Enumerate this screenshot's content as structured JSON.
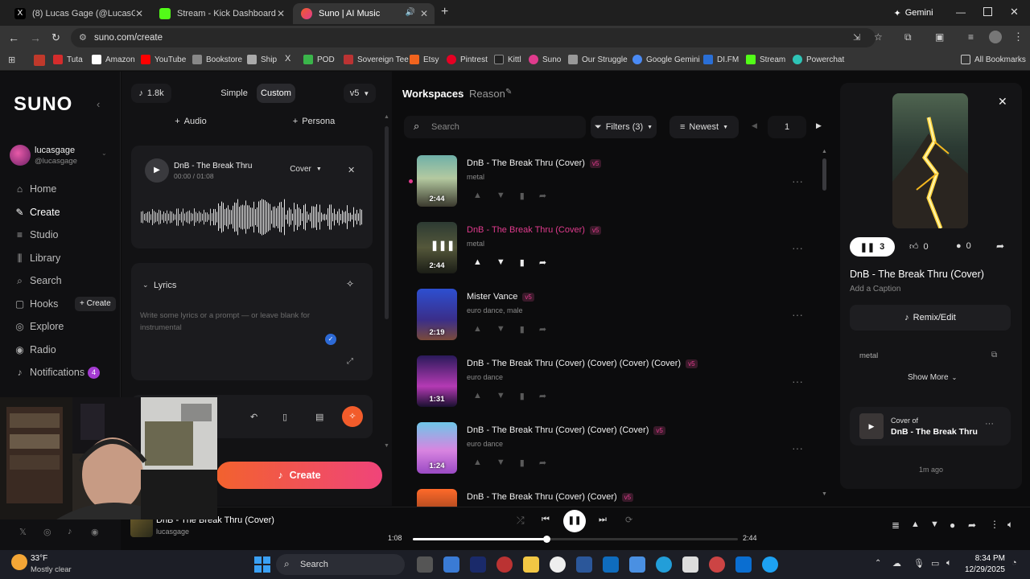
{
  "browser": {
    "tabs": [
      {
        "label": "(8) Lucas Gage (@LucasGageX)",
        "active": false
      },
      {
        "label": "Stream - Kick Dashboard",
        "active": false
      },
      {
        "label": "Suno | AI Music",
        "active": true
      }
    ],
    "gemini_label": "Gemini",
    "url": "suno.com/create",
    "bookmarks": [
      "Tuta",
      "Amazon",
      "YouTube",
      "Bookstore",
      "Ship",
      "POD",
      "Sovereign Tee",
      "Etsy",
      "Pintrest",
      "Kittl",
      "Suno",
      "Our Struggle",
      "Google Gemini",
      "DI.FM",
      "Stream",
      "Powerchat"
    ],
    "all_bookmarks": "All Bookmarks"
  },
  "sidebar": {
    "logo": "SUNO",
    "user_name": "lucasgage",
    "user_handle": "@lucasgage",
    "items": [
      {
        "label": "Home",
        "icon": "home-icon"
      },
      {
        "label": "Create",
        "icon": "create-icon"
      },
      {
        "label": "Studio",
        "icon": "studio-icon"
      },
      {
        "label": "Library",
        "icon": "library-icon"
      },
      {
        "label": "Search",
        "icon": "search-icon"
      },
      {
        "label": "Hooks",
        "icon": "hooks-icon"
      },
      {
        "label": "Explore",
        "icon": "explore-icon"
      },
      {
        "label": "Radio",
        "icon": "radio-icon"
      },
      {
        "label": "Notifications",
        "icon": "bell-icon"
      }
    ],
    "hooks_create": "+ Create",
    "notifications_count": "4"
  },
  "create": {
    "credits": "1.8k",
    "mode_simple": "Simple",
    "mode_custom": "Custom",
    "model": "v5",
    "audio_btn": "Audio",
    "persona_btn": "Persona",
    "track_title": "DnB - The Break Thru",
    "track_time": "00:00 / 01:08",
    "cover_label": "Cover",
    "lyrics_label": "Lyrics",
    "lyrics_placeholder": "Write some lyrics or a prompt — or leave blank for instrumental",
    "create_btn": "Create"
  },
  "workspace": {
    "crumb_root": "Workspaces",
    "crumb_current": "Reason",
    "search_placeholder": "Search",
    "filters": "Filters (3)",
    "sort": "Newest",
    "page": "1",
    "songs": [
      {
        "title": "DnB - The Break Thru (Cover)",
        "tags": "metal",
        "duration": "2:44",
        "badge": "v5",
        "playing": false
      },
      {
        "title": "DnB - The Break Thru (Cover)",
        "tags": "metal",
        "duration": "2:44",
        "badge": "v5",
        "playing": true
      },
      {
        "title": "Mister Vance",
        "tags": "euro dance, male",
        "duration": "2:19",
        "badge": "v5",
        "playing": false
      },
      {
        "title": "DnB - The Break Thru (Cover) (Cover) (Cover) (Cover)",
        "tags": "euro dance",
        "duration": "1:31",
        "badge": "v5",
        "playing": false
      },
      {
        "title": "DnB - The Break Thru (Cover) (Cover) (Cover)",
        "tags": "euro dance",
        "duration": "1:24",
        "badge": "v5",
        "playing": false
      },
      {
        "title": "DnB - The Break Thru (Cover) (Cover)",
        "tags": "",
        "duration": "",
        "badge": "v5",
        "playing": false
      }
    ]
  },
  "detail": {
    "plays": "3",
    "likes": "0",
    "comments": "0",
    "title": "DnB - The Break Thru (Cover)",
    "caption": "Add a Caption",
    "remix": "Remix/Edit",
    "style": "metal",
    "show_more": "Show More",
    "cover_of_label": "Cover of",
    "cover_of_title": "DnB - The Break Thru",
    "age": "1m ago"
  },
  "player": {
    "title": "DnB - The Break Thru (Cover)",
    "artist": "lucasgage",
    "elapsed": "1:08",
    "total": "2:44",
    "progress": 0.41
  },
  "taskbar": {
    "weather_temp": "33°F",
    "weather_desc": "Mostly clear",
    "search": "Search",
    "time": "8:34 PM",
    "date": "12/29/2025"
  },
  "colors": {
    "accent": "#f25c2b",
    "pink": "#e03b8d",
    "bg": "#0c0c0d"
  }
}
